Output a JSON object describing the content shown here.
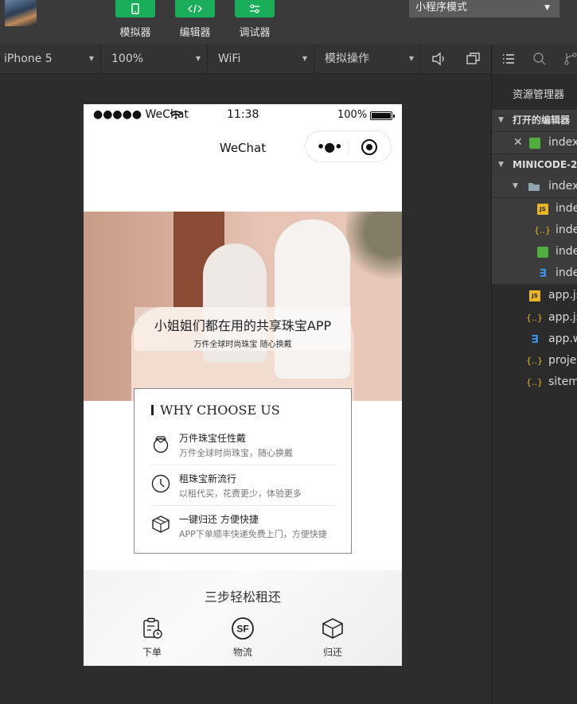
{
  "toolbar": {
    "tools": [
      {
        "label": "模拟器"
      },
      {
        "label": "编辑器"
      },
      {
        "label": "调试器"
      }
    ],
    "mode": "小程序模式"
  },
  "devbar": {
    "device": "iPhone 5",
    "zoom": "100%",
    "network": "WiFi",
    "operation": "模拟操作"
  },
  "phone": {
    "status": {
      "carrier": "●●●●● WeChat",
      "time": "11:38",
      "battery": "100%"
    },
    "nav_title": "WeChat",
    "capsule_dots": "•●•",
    "hero": {
      "headline": "小姐姐们都在用的共享珠宝APP",
      "subline": "万件全球时尚珠宝 随心换戴"
    },
    "why": {
      "heading": "WHY CHOOSE US",
      "items": [
        {
          "title": "万件珠宝任性戴",
          "desc": "万件全球时尚珠宝，随心换戴",
          "icon": "ring-icon"
        },
        {
          "title": "租珠宝新流行",
          "desc": "以租代买，花费更少，体验更多",
          "icon": "clock-icon"
        },
        {
          "title": "一键归还 方便快捷",
          "desc": "APP下单顺丰快递免费上门，方便快捷",
          "icon": "box-icon"
        }
      ]
    },
    "steps": {
      "title": "三步轻松租还",
      "items": [
        {
          "label": "下单",
          "icon": "clipboard-icon"
        },
        {
          "label": "物流",
          "icon": "sf-logo-icon",
          "logo_text": "SF"
        },
        {
          "label": "归还",
          "icon": "box-icon"
        }
      ]
    }
  },
  "sidebar": {
    "title": "资源管理器",
    "open_editors": "打开的编辑器",
    "open_file": "index",
    "project": "MINICODE-2",
    "folder": "index",
    "folder_files": [
      "inde",
      "inde",
      "inde",
      "inde"
    ],
    "root_files": [
      "app.js",
      "app.js",
      "app.w",
      "proje",
      "sitem"
    ]
  }
}
